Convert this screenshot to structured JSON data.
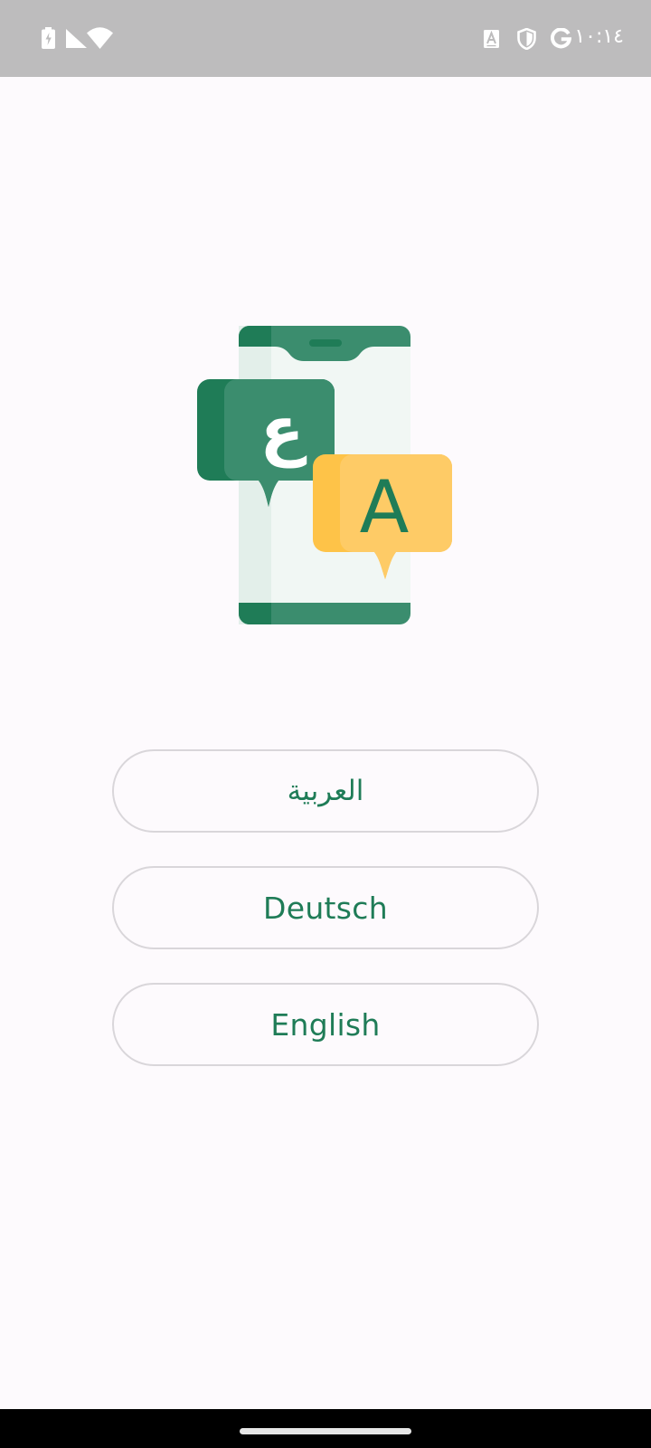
{
  "status_bar": {
    "time": "١٠:١٤",
    "left_icons": [
      "battery-charging-icon",
      "cell-signal-icon",
      "wifi-icon"
    ],
    "right_icons": [
      "text-input-icon",
      "shield-icon",
      "google-icon"
    ]
  },
  "hero": {
    "icon": "translation-illustration",
    "bubble_left_glyph": "ع",
    "bubble_right_glyph": "A"
  },
  "languages": [
    {
      "label": "العربية"
    },
    {
      "label": "Deutsch"
    },
    {
      "label": "English"
    }
  ],
  "colors": {
    "background": "#FDFAFD",
    "status_bar": "#BDBCBD",
    "accent_green": "#1F7C57",
    "accent_green_light": "#3B8D6E",
    "accent_yellow": "#FECB66",
    "button_border": "#D9D6DA"
  }
}
